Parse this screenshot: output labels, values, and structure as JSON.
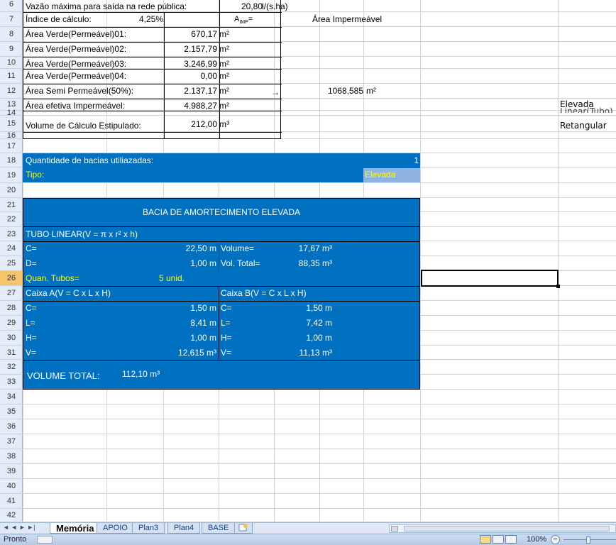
{
  "rows": [
    "6",
    "7",
    "8",
    "9",
    "10",
    "11",
    "12",
    "13",
    "14",
    "15",
    "16",
    "17",
    "18",
    "19",
    "20",
    "21",
    "22",
    "23",
    "24",
    "25",
    "26",
    "27",
    "28",
    "29",
    "30",
    "31",
    "32",
    "33",
    "34",
    "35",
    "36",
    "37",
    "38",
    "39",
    "40",
    "41",
    "42"
  ],
  "block1": {
    "r6_label": "Vazão máxima para saída na rede pública:",
    "r6_value": "20,80",
    "r6_unit": "l/(s.ha)",
    "r7_label": "Índice de cálculo:",
    "r7_value": "4,25%",
    "r7_aimp": "A",
    "r7_aimp_sub": "IMP",
    "r7_aimp_eq": "=",
    "r7_text": "Área Impermeável",
    "r8_label": "Área Verde(Permeável)01:",
    "r8_value": "670,17",
    "r9_label": "Área Verde(Permeável)02:",
    "r9_value": "2.157,79",
    "r10_label": "Área Verde(Permeável)03:",
    "r10_value": "3.246,99",
    "r11_label": "Área Verde(Permeável)04:",
    "r11_value": "0,00",
    "r12_label": "Área Semi Permeável(50%):",
    "r12_value": "2.137,17",
    "r12_arrow": "→",
    "r12_result": "1068,585",
    "r13_label": "Área efetiva Impermeável:",
    "r13_value": "4.988,27",
    "r15_label": "Volume de Cálculo Estipulado:",
    "r15_value": "212,00",
    "unit_m2": "m²",
    "unit_m3": "m³"
  },
  "side_list": {
    "i1": "Elevada",
    "i2": "Linear(Tubo)",
    "i3": "Retangular"
  },
  "block2": {
    "r18_label": "Quantidade de bacias utiliazadas:",
    "r18_value": "1",
    "r19_label": "Tipo:",
    "r19_value": "Elevada"
  },
  "block3": {
    "title": "BACIA DE AMORTECIMENTO  ELEVADA",
    "r23": "TUBO LINEAR(V = π x r² x h)",
    "r24_label": "C=",
    "r24_value": "22,50 m",
    "r24_vlabel": "Volume=",
    "r24_vvalue": "17,67 m³",
    "r25_label": "D=",
    "r25_value": "1,00 m",
    "r25_vlabel": "Vol. Total=",
    "r25_vvalue": "88,35 m³",
    "r26_label": "Quan. Tubos=",
    "r26_value": "5 unid.",
    "r27_a": "Caixa A(V = C x L x H)",
    "r27_b": "Caixa B(V = C x L x H)",
    "r28_la": "C=",
    "r28_va": "1,50 m",
    "r28_lb": "C=",
    "r28_vb": "1,50 m",
    "r29_la": "L=",
    "r29_va": "8,41 m",
    "r29_lb": "L=",
    "r29_vb": "7,42 m",
    "r30_la": "H=",
    "r30_va": "1,00 m",
    "r30_lb": "H=",
    "r30_vb": "1,00 m",
    "r31_la": "V=",
    "r31_va": "12,615 m³",
    "r31_lb": "V=",
    "r31_vb": "11,13 m³",
    "total_label": "VOLUME TOTAL:",
    "total_value": "112,10 m³"
  },
  "tabs": [
    "Memória",
    "APOIO",
    "Plan3",
    "Plan4",
    "BASE"
  ],
  "nav": "◄ ◄ ► ►|",
  "status": {
    "ready": "Pronto",
    "zoom": "100%",
    "minus": "−"
  },
  "colors": {
    "cell_blue": "#0070c0",
    "yellow_text": "#ffff00",
    "header_bg": "#e4ecf7"
  }
}
